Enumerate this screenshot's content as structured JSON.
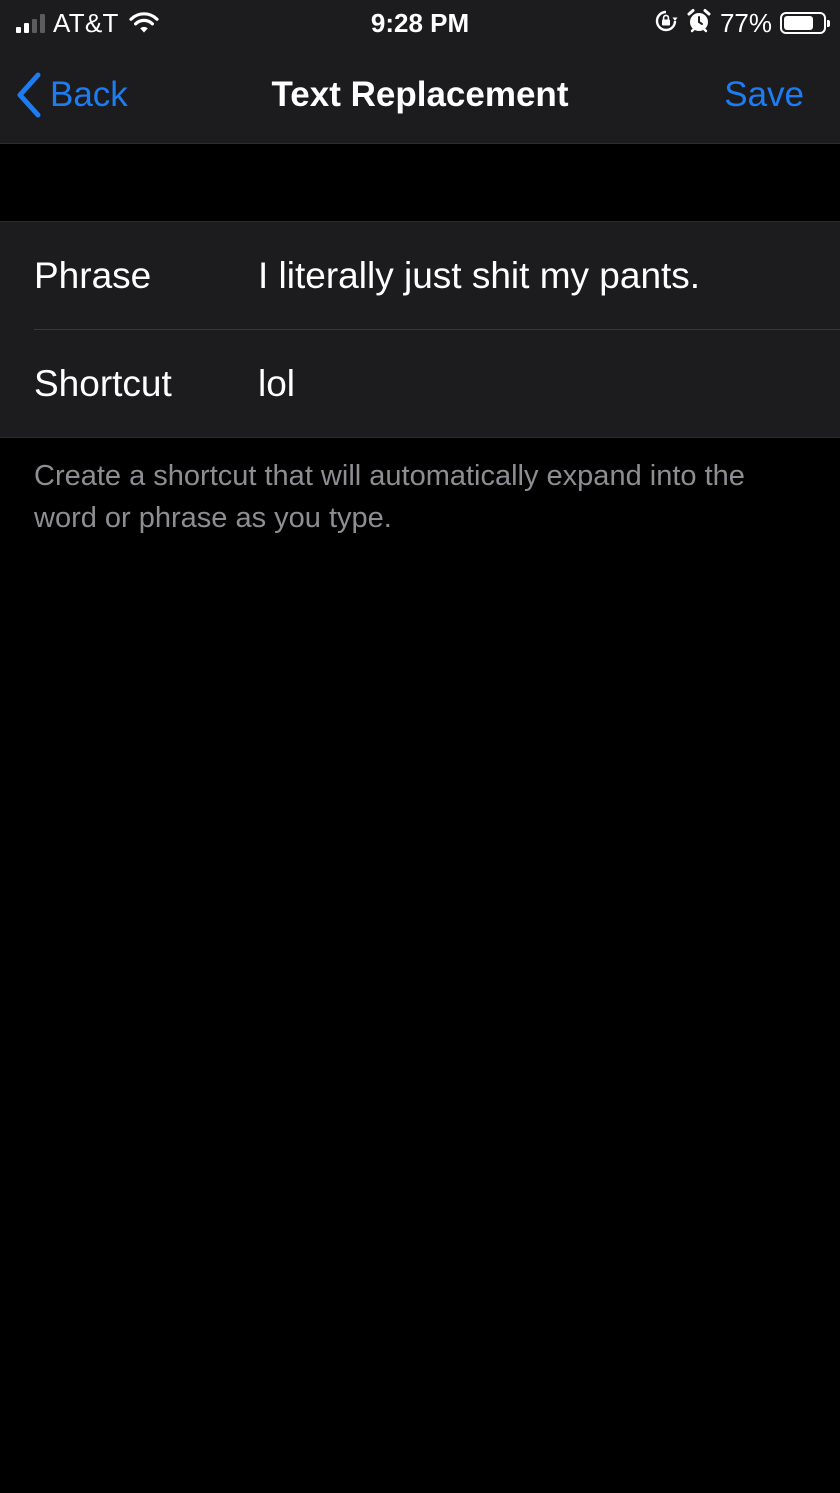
{
  "status_bar": {
    "carrier": "AT&T",
    "time": "9:28 PM",
    "battery_percent": "77%",
    "battery_level": 0.77,
    "signal_bars_active": 2,
    "signal_bars_total": 4,
    "icons": [
      "signal-icon",
      "wifi-icon",
      "rotation-lock-icon",
      "alarm-icon",
      "battery-icon"
    ]
  },
  "nav": {
    "back_label": "Back",
    "title": "Text Replacement",
    "save_label": "Save",
    "accent_color": "#1e7cf2"
  },
  "form": {
    "phrase": {
      "label": "Phrase",
      "value": "I literally just shit my pants."
    },
    "shortcut": {
      "label": "Shortcut",
      "value": "lol"
    }
  },
  "footer": {
    "note": "Create a shortcut that will automatically expand into the word or phrase as you type."
  },
  "colors": {
    "background": "#000000",
    "group_background": "#1c1c1e",
    "secondary_text": "#8d8d92"
  }
}
